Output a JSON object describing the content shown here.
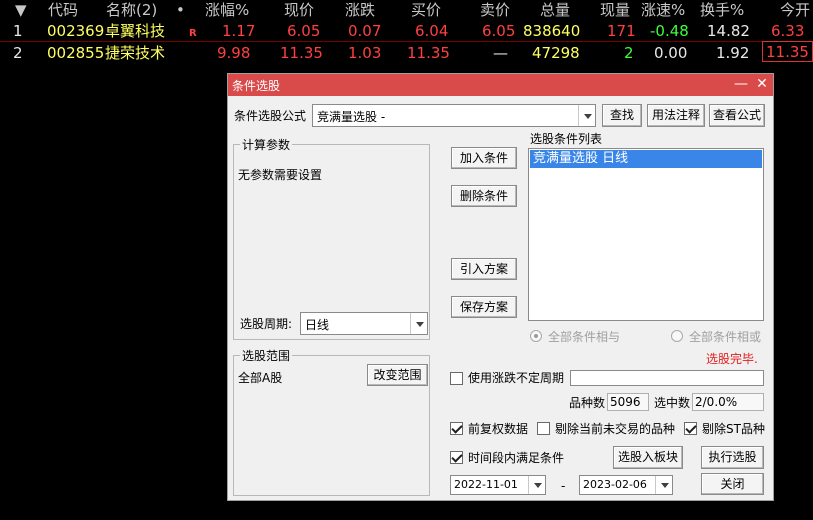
{
  "table": {
    "sort_indicator": "▼",
    "headers": [
      "代码",
      "名称(2)",
      "•",
      "涨幅%",
      "现价",
      "涨跌",
      "买价",
      "卖价",
      "总量",
      "现量",
      "涨速%",
      "换手%",
      "今开"
    ],
    "rows": [
      {
        "idx": "1",
        "code": "002369",
        "name": "卓翼科技",
        "flag": "R",
        "change_pct": "1.17",
        "price": "6.05",
        "change": "0.07",
        "bid": "6.04",
        "ask": "6.05",
        "volume": "838640",
        "cur_vol": "171",
        "speed": "-0.48",
        "turnover": "14.82",
        "open": "6.33"
      },
      {
        "idx": "2",
        "code": "002855",
        "name": "捷荣技术",
        "flag": "",
        "change_pct": "9.98",
        "price": "11.35",
        "change": "1.03",
        "bid": "11.35",
        "ask": "—",
        "volume": "47298",
        "cur_vol": "2",
        "speed": "0.00",
        "turnover": "1.92",
        "open": "11.35"
      }
    ]
  },
  "dialog": {
    "title": "条件选股",
    "minimize_glyph": "—",
    "close_glyph": "✕",
    "formula_label": "条件选股公式",
    "formula_value": "竞满量选股   -",
    "find_btn": "查找",
    "usage_btn": "用法注释",
    "view_btn": "查看公式",
    "params_group": "计算参数",
    "no_params": "无参数需要设置",
    "period_label": "选股周期:",
    "period_value": "日线",
    "add_btn": "加入条件",
    "delete_btn": "删除条件",
    "import_btn": "引入方案",
    "save_btn": "保存方案",
    "list_title": "选股条件列表",
    "list_items": [
      "竞满量选股  日线"
    ],
    "radio_and": "全部条件相与",
    "radio_or": "全部条件相或",
    "status": "选股完毕.",
    "range_group": "选股范围",
    "range_value": "全部A股",
    "change_range_btn": "改变范围",
    "use_period_label": "使用涨跌不定周期",
    "count_label": "品种数",
    "count_value": "5096",
    "selected_label": "选中数",
    "selected_value": "2/0.0%",
    "fq_label": "前复权数据",
    "exclude_label": "剔除当前未交易的品种",
    "st_label": "剔除ST品种",
    "timespan_label": "时间段内满足条件",
    "to_block_btn": "选股入板块",
    "exec_btn": "执行选股",
    "date_from": "2022-11-01",
    "date_sep": "-",
    "date_to": "2023-02-06",
    "close_btn": "关闭"
  }
}
